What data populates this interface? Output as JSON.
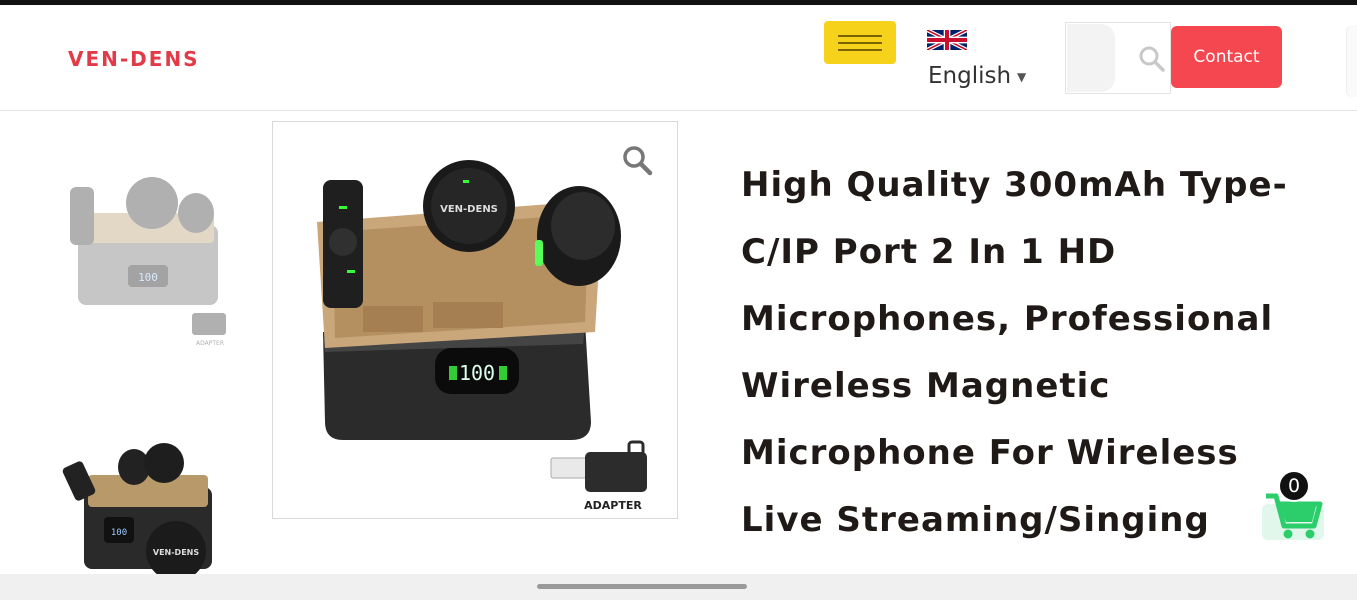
{
  "header": {
    "logo_text": "VEN-DENS",
    "menu_icon": "hamburger-icon",
    "language": {
      "label": "English",
      "flag_icon": "uk-flag-icon",
      "caret": "▼"
    },
    "search": {
      "placeholder": "",
      "icon": "search-icon"
    },
    "contact_label": "Contact"
  },
  "gallery": {
    "thumbnails": [
      {
        "label": "ADAPTER",
        "icon": "microphone-kit-thumbnail"
      },
      {
        "brand": "VEN-DENS",
        "display": "100",
        "icon": "microphone-kit-dark-thumbnail"
      }
    ],
    "main_image": {
      "brand": "VEN-DENS",
      "display": "100",
      "adapter_label": "ADAPTER",
      "zoom_icon": "zoom-icon"
    }
  },
  "product": {
    "title": "High Quality 300mAh Type-C/IP Port 2 In 1 HD Microphones, Professional Wireless Magnetic Microphone For Wireless Live Streaming/Singing"
  },
  "cart": {
    "count": "0",
    "icon": "shopping-cart-icon"
  },
  "colors": {
    "brand_red": "#e23b47",
    "menu_yellow": "#f7d21a",
    "contact_red": "#f5474f",
    "cart_green": "#2ccd6b"
  }
}
